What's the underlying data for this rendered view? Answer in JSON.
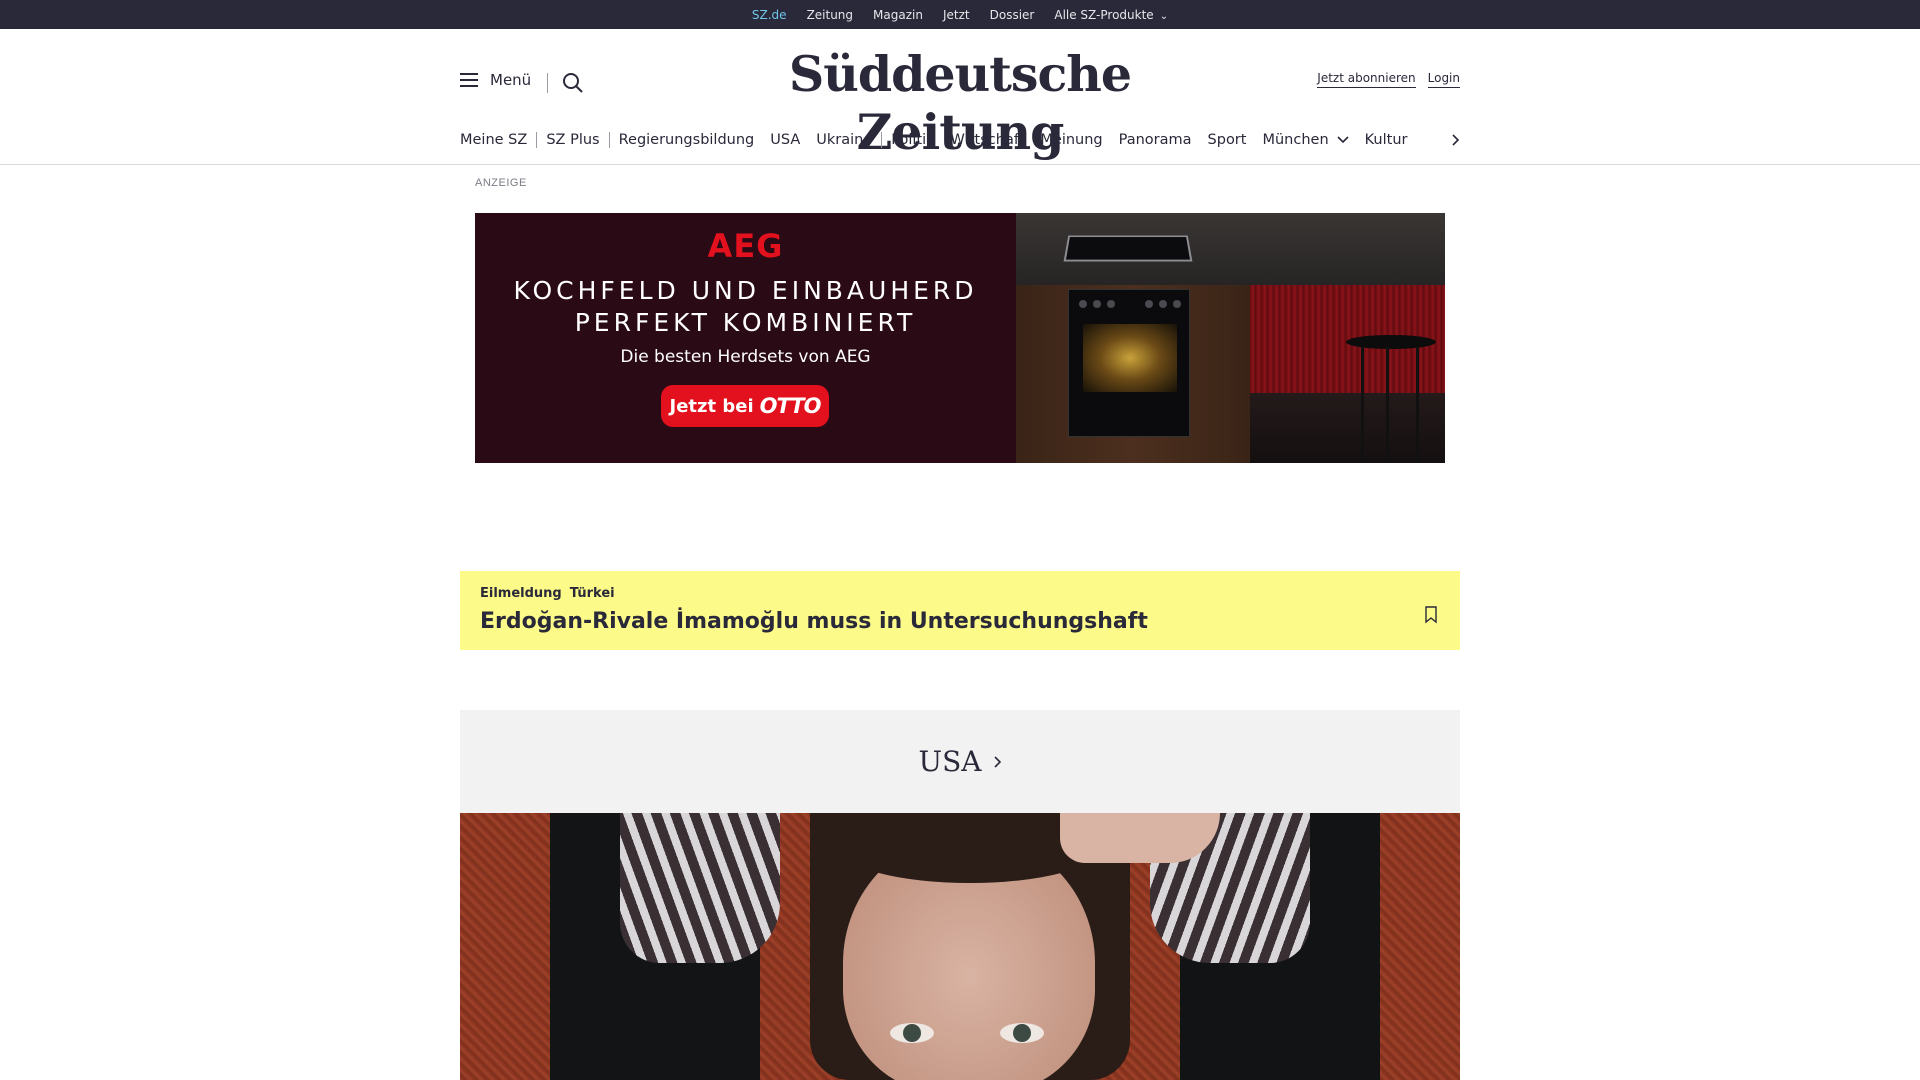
{
  "topbar": {
    "links": [
      "SZ.de",
      "Zeitung",
      "Magazin",
      "Jetzt",
      "Dossier",
      "Alle SZ-Produkte"
    ]
  },
  "header": {
    "menu_label": "Menü",
    "logo": "Süddeutsche Zeitung",
    "subscribe": "Jetzt abonnieren",
    "login": "Login"
  },
  "nav": {
    "items": [
      "Meine SZ",
      "SZ Plus",
      "Regierungsbildung",
      "USA",
      "Ukraine",
      "Politik",
      "Wirtschaft",
      "Meinung",
      "Panorama",
      "Sport",
      "München",
      "Kultur"
    ]
  },
  "ad": {
    "label": "ANZEIGE",
    "brand": "AEG",
    "headline_1": "KOCHFELD UND EINBAUHERD",
    "headline_2": "PERFEKT KOMBINIERT",
    "subline": "Die besten Herdsets von AEG",
    "cta_prefix": "Jetzt bei",
    "cta_brand": "OTTO"
  },
  "breaking": {
    "tag": "Eilmeldung",
    "topic": "Türkei",
    "title": "Erdoğan-Rivale İmamoğlu muss in Untersuchungshaft"
  },
  "section": {
    "title": "USA"
  },
  "colors": {
    "topbar_bg": "#29293a",
    "active_link": "#71c5e8",
    "breaking_bg": "#fcfa88",
    "ad_red": "#e3101d"
  }
}
